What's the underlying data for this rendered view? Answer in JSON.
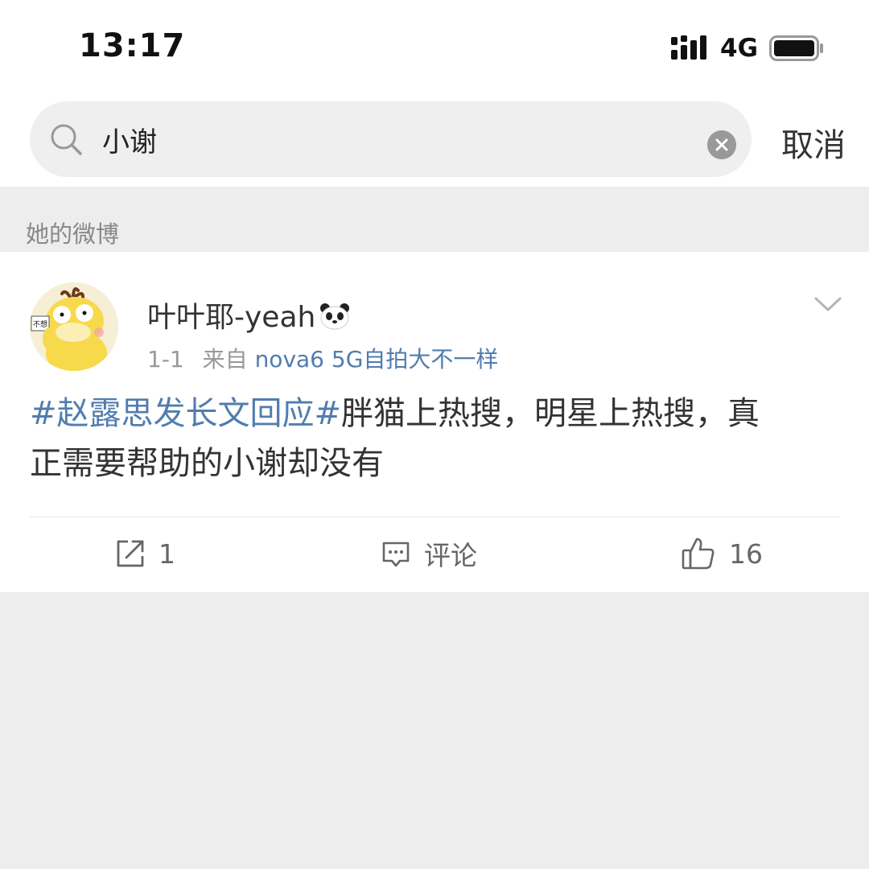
{
  "status_bar": {
    "time": "13:17",
    "network": "4G"
  },
  "search": {
    "query": "小谢",
    "cancel_label": "取消"
  },
  "section": {
    "label": "她的微博"
  },
  "post": {
    "username": "叶叶耶-yeah",
    "date": "1-1",
    "source_prefix": "来自",
    "source": "nova6 5G自拍大不一样",
    "hashtag": "#赵露思发长文回应#",
    "text_line1_rest": "胖猫上热搜，明星上热搜，真",
    "text_line2": "正需要帮助的小谢却没有",
    "avatar_label": "不想",
    "actions": {
      "repost_count": "1",
      "comment_label": "评论",
      "like_count": "16"
    }
  },
  "colors": {
    "link_blue": "#507daf",
    "background": "#ededed",
    "card": "#ffffff"
  }
}
